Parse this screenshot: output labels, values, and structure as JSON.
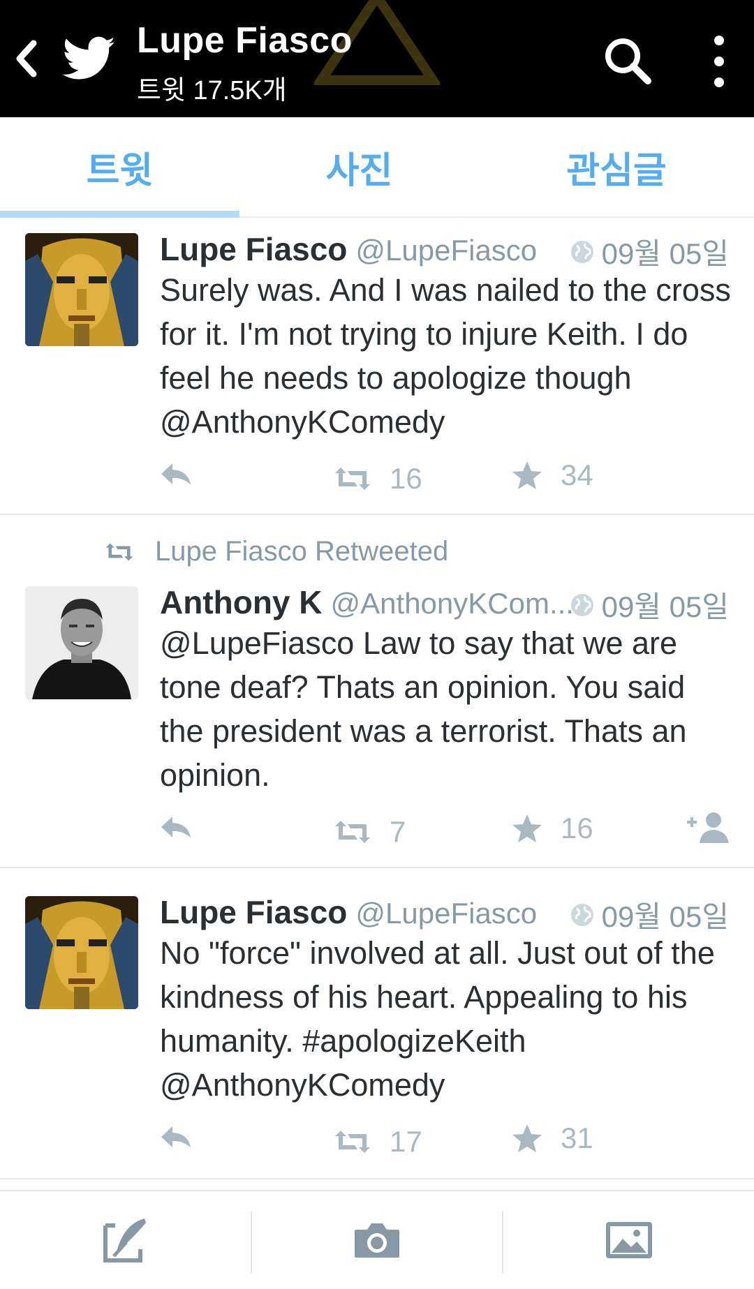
{
  "header": {
    "title": "Lupe Fiasco",
    "subtitle": "트윗 17.5K개"
  },
  "tabs": [
    {
      "label": "트윗",
      "selected": true
    },
    {
      "label": "사진",
      "selected": false
    },
    {
      "label": "관심글",
      "selected": false
    }
  ],
  "tweets": [
    {
      "name": "Lupe Fiasco",
      "handle": "@LupeFiasco",
      "time": "09월 05일",
      "text": "Surely was. And I was nailed to the cross for it. I'm not trying to injure Keith. I do feel he needs to apologize though  @AnthonyKComedy",
      "retweets": "16",
      "favorites": "34"
    },
    {
      "retweeted_by": "Lupe Fiasco Retweeted",
      "name": "Anthony K",
      "handle": "@AnthonyKCom...",
      "time": "09월 05일",
      "text": "@LupeFiasco Law to say that we are tone deaf? Thats an opinion. You said the president was a terrorist. Thats an opinion.",
      "retweets": "7",
      "favorites": "16"
    },
    {
      "name": "Lupe Fiasco",
      "handle": "@LupeFiasco",
      "time": "09월 05일",
      "text": "No \"force\" involved at all. Just out of the kindness of his heart. Appealing to his humanity. #apologizeKeith @AnthonyKComedy",
      "retweets": "17",
      "favorites": "31"
    }
  ],
  "icons": {
    "back": "chevron-left-icon",
    "logo": "twitter-bird-icon",
    "search": "search-icon",
    "more": "more-vertical-icon",
    "reply": "reply-icon",
    "retweet": "retweet-icon",
    "favorite": "star-icon",
    "follow": "add-user-icon",
    "compose": "compose-icon",
    "camera": "camera-icon",
    "gallery": "image-icon"
  },
  "colors": {
    "accent": "#55acee",
    "tab_indicator": "#b5dbf6",
    "icon_gray": "#aab8c2",
    "meta_gray": "#8899a6",
    "text": "#292f33",
    "topbar": "#000000"
  }
}
